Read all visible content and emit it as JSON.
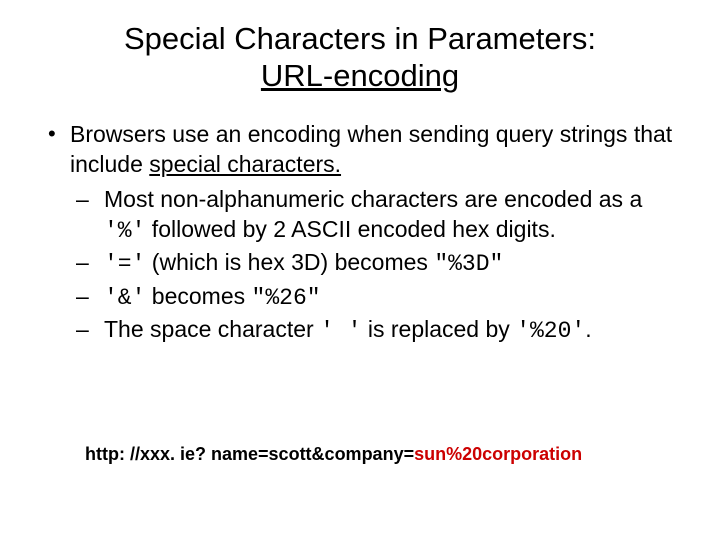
{
  "title": {
    "line1": "Special Characters in Parameters:",
    "line2": "URL-encoding"
  },
  "bullet1": {
    "pre": "Browsers use an encoding when sending query strings that include ",
    "underlined": "special characters.",
    "sub": {
      "item1": {
        "pre": "Most non-alphanumeric characters are encoded as a ",
        "code1": "'%'",
        "post": " followed by 2 ASCII encoded hex digits."
      },
      "item2": {
        "code1": "'='",
        "mid": " (which is hex 3D) becomes ",
        "code2": "\"%3D\""
      },
      "item3": {
        "code1": "'&'",
        "mid": " becomes ",
        "code2": "\"%26\""
      },
      "item4": {
        "pre": "The space character ",
        "code1": "' '",
        "mid": " is replaced by ",
        "code2": "'%20'",
        "post": "."
      }
    }
  },
  "footer": {
    "plain": "http: //xxx. ie? name=scott&company=",
    "encoded": "sun%20corporation"
  }
}
